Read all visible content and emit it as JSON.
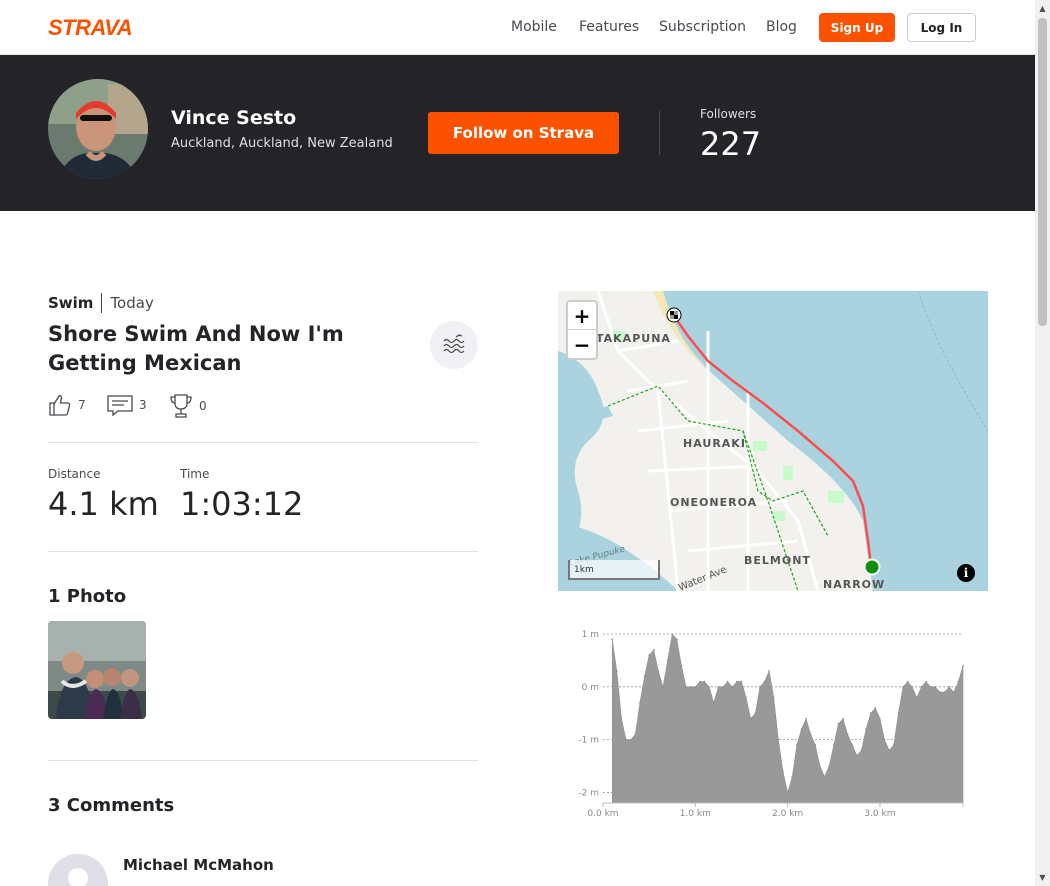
{
  "nav": {
    "brand": "STRAVA",
    "links": [
      "Mobile",
      "Features",
      "Subscription",
      "Blog"
    ],
    "signup_label": "Sign Up",
    "login_label": "Log In"
  },
  "athlete": {
    "name": "Vince Sesto",
    "location": "Auckland, Auckland, New Zealand",
    "follow_label": "Follow on Strava",
    "followers_label": "Followers",
    "followers_count": "227"
  },
  "activity": {
    "type": "Swim",
    "date": "Today",
    "title": "Shore Swim And Now I'm Getting Mexican",
    "kudos": "7",
    "comments": "3",
    "achievements": "0",
    "distance_label": "Distance",
    "distance_value": "4.1 km",
    "time_label": "Time",
    "time_value": "1:03:12"
  },
  "photos": {
    "heading": "1 Photo"
  },
  "comments": {
    "heading": "3 Comments",
    "first_author": "Michael McMahon"
  },
  "map": {
    "zoom_in": "+",
    "zoom_out": "−",
    "scale_label": "1km",
    "info": "i",
    "labels": [
      "TAKAPUNA",
      "HAURAKI",
      "ONEONEROA",
      "BELMONT",
      "NARROW",
      "Lake Pupuke",
      "Water Ave"
    ]
  },
  "chart_data": {
    "type": "area",
    "xlabel": "",
    "ylabel": "",
    "xlim": [
      0,
      3.9
    ],
    "ylim": [
      -2.2,
      1
    ],
    "y_ticks": [
      "1 m",
      "0 m",
      "-1 m",
      "-2 m"
    ],
    "y_tick_values": [
      1,
      0,
      -1,
      -2
    ],
    "x_ticks": [
      "0.0 km",
      "1.0 km",
      "2.0 km",
      "3.0 km"
    ],
    "x_tick_values": [
      0,
      1,
      2,
      3
    ],
    "grid": true,
    "x": [
      0.1,
      0.15,
      0.2,
      0.25,
      0.3,
      0.35,
      0.4,
      0.45,
      0.5,
      0.55,
      0.6,
      0.65,
      0.7,
      0.75,
      0.8,
      0.85,
      0.9,
      0.95,
      1.0,
      1.05,
      1.1,
      1.15,
      1.2,
      1.25,
      1.3,
      1.35,
      1.4,
      1.45,
      1.5,
      1.55,
      1.6,
      1.65,
      1.7,
      1.75,
      1.8,
      1.85,
      1.9,
      1.95,
      2.0,
      2.05,
      2.1,
      2.15,
      2.2,
      2.25,
      2.3,
      2.35,
      2.4,
      2.45,
      2.5,
      2.55,
      2.6,
      2.65,
      2.7,
      2.75,
      2.8,
      2.85,
      2.9,
      2.95,
      3.0,
      3.05,
      3.1,
      3.15,
      3.2,
      3.25,
      3.3,
      3.35,
      3.4,
      3.45,
      3.5,
      3.55,
      3.6,
      3.65,
      3.7,
      3.75,
      3.8,
      3.85,
      3.9
    ],
    "values": [
      0.9,
      0.3,
      -0.6,
      -1.0,
      -1.0,
      -0.9,
      -0.3,
      0.2,
      0.6,
      0.7,
      0.3,
      0.0,
      0.5,
      1.0,
      0.9,
      0.4,
      0.0,
      0.0,
      0.0,
      0.1,
      0.1,
      0.0,
      -0.3,
      0.0,
      0.0,
      0.1,
      0.0,
      0.1,
      0.1,
      -0.2,
      -0.6,
      -0.5,
      0.0,
      0.1,
      0.3,
      -0.2,
      -1.0,
      -1.6,
      -2.0,
      -1.7,
      -1.1,
      -0.8,
      -0.6,
      -0.9,
      -1.1,
      -1.5,
      -1.7,
      -1.5,
      -1.1,
      -0.7,
      -0.6,
      -0.9,
      -1.1,
      -1.3,
      -1.2,
      -0.8,
      -0.5,
      -0.4,
      -0.6,
      -1.0,
      -1.2,
      -1.1,
      -0.5,
      0.0,
      0.1,
      0.0,
      -0.2,
      0.0,
      0.1,
      0.0,
      0.0,
      -0.1,
      -0.1,
      0.0,
      -0.1,
      0.1,
      0.4
    ]
  }
}
